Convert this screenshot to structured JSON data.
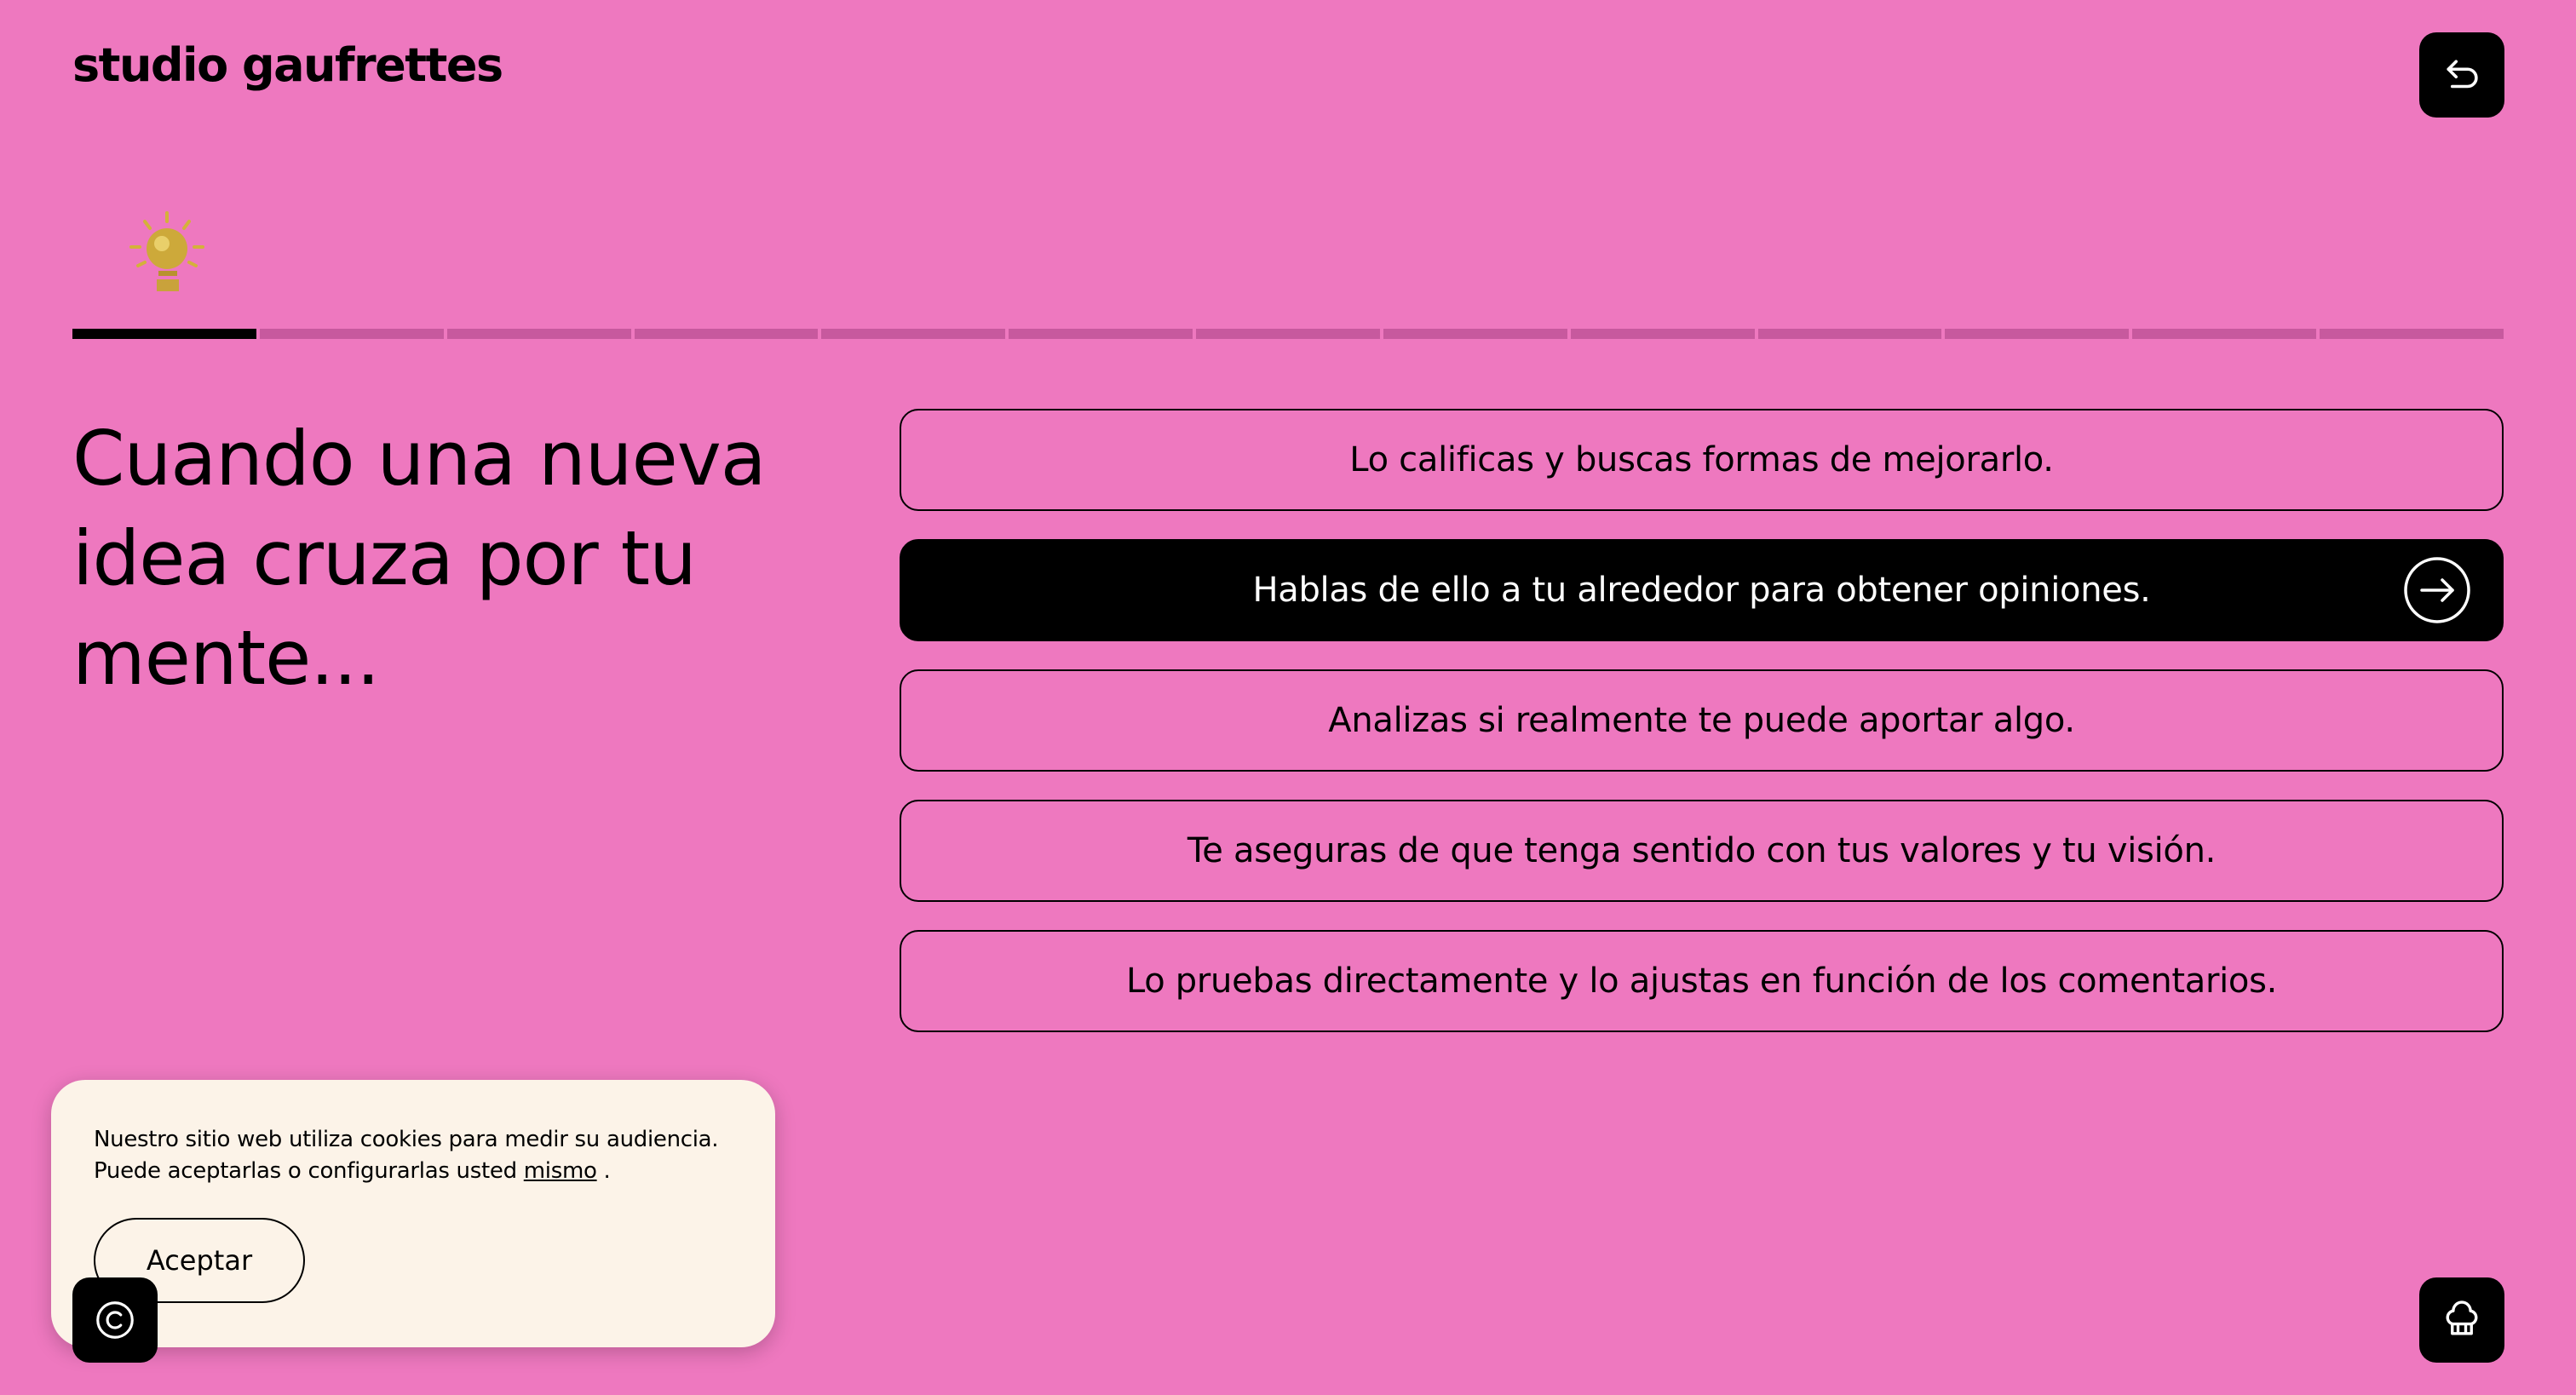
{
  "header": {
    "logo": "studio gaufrettes",
    "back_icon": "undo-arrow-icon"
  },
  "progress": {
    "current_step": 1,
    "total_steps": 13,
    "step_icon": "lightbulb-icon"
  },
  "question": {
    "text": "Cuando una nueva idea cruza por tu mente..."
  },
  "options": [
    {
      "label": "Lo calificas y buscas formas de mejorarlo.",
      "selected": false
    },
    {
      "label": "Hablas de ello a tu alrededor para obtener opiniones.",
      "selected": true
    },
    {
      "label": "Analizas si realmente te puede aportar algo.",
      "selected": false
    },
    {
      "label": "Te aseguras de que tenga sentido con tus valores y tu visión.",
      "selected": false
    },
    {
      "label": "Lo pruebas directamente y lo ajustas en función de los comentarios.",
      "selected": false
    }
  ],
  "cookie_banner": {
    "line1": "Nuestro sitio web utiliza cookies para medir su audiencia.",
    "line2_prefix": "Puede aceptarlas o configurarlas usted",
    "link_text": "mismo",
    "line2_suffix": " .",
    "accept_label": "Aceptar"
  },
  "footer": {
    "copyright_icon": "copyright-icon",
    "chef_icon": "chef-hat-icon"
  },
  "colors": {
    "background": "#EE78BF",
    "progress_inactive": "#C7599E",
    "accent": "#000000",
    "cookie_background": "#FCF3E8",
    "lightbulb": "#D4B13A"
  }
}
